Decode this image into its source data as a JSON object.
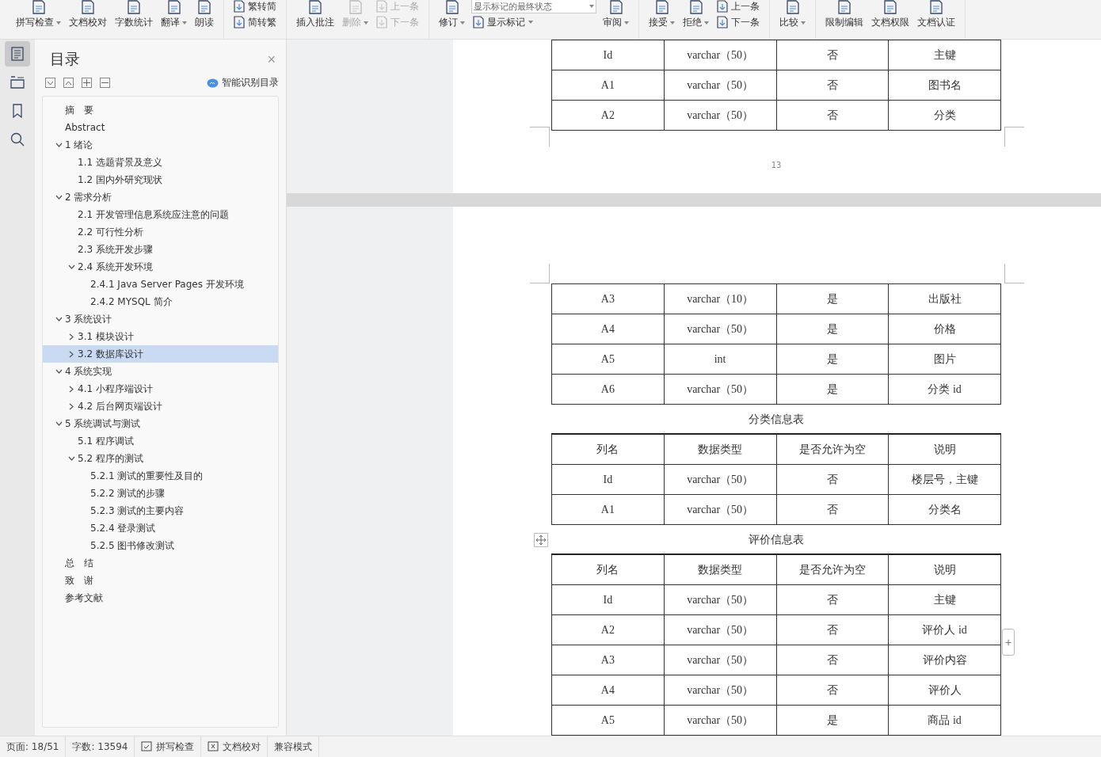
{
  "toolbar": {
    "groups": [
      {
        "items": [
          {
            "kind": "big",
            "label": "拼写检查",
            "caret": true,
            "disabled": false
          },
          {
            "kind": "big",
            "label": "文档校对",
            "caret": false,
            "disabled": false
          },
          {
            "kind": "big",
            "label": "字数统计",
            "caret": false,
            "disabled": false
          },
          {
            "kind": "big",
            "label": "翻译",
            "caret": true,
            "disabled": false
          },
          {
            "kind": "big",
            "label": "朗读",
            "caret": false,
            "disabled": false
          }
        ]
      },
      {
        "items": [
          {
            "kind": "stack",
            "rows": [
              {
                "label": "繁转简",
                "caret": false,
                "disabled": false
              },
              {
                "label": "简转繁",
                "caret": false,
                "disabled": false
              }
            ]
          }
        ]
      },
      {
        "items": [
          {
            "kind": "big",
            "label": "插入批注",
            "caret": false,
            "disabled": false
          },
          {
            "kind": "big",
            "label": "删除",
            "caret": true,
            "disabled": true
          },
          {
            "kind": "stack",
            "rows": [
              {
                "label": "上一条",
                "caret": false,
                "disabled": true
              },
              {
                "label": "下一条",
                "caret": false,
                "disabled": true
              }
            ]
          }
        ]
      },
      {
        "items": [
          {
            "kind": "big",
            "label": "修订",
            "caret": true,
            "disabled": false
          },
          {
            "kind": "stack",
            "rows": [
              {
                "label": "显示标记的最终状态",
                "caret": true,
                "field": true
              },
              {
                "label": "显示标记",
                "caret": true,
                "disabled": false
              }
            ]
          },
          {
            "kind": "big",
            "label": "审阅",
            "caret": true,
            "disabled": false
          }
        ]
      },
      {
        "items": [
          {
            "kind": "big",
            "label": "接受",
            "caret": true,
            "disabled": false
          },
          {
            "kind": "big",
            "label": "拒绝",
            "caret": true,
            "disabled": false
          },
          {
            "kind": "stack",
            "rows": [
              {
                "label": "上一条",
                "caret": false,
                "disabled": false
              },
              {
                "label": "下一条",
                "caret": false,
                "disabled": false
              }
            ]
          }
        ]
      },
      {
        "items": [
          {
            "kind": "big",
            "label": "比较",
            "caret": true,
            "disabled": false
          }
        ]
      },
      {
        "items": [
          {
            "kind": "big",
            "label": "限制编辑",
            "caret": false,
            "disabled": false
          },
          {
            "kind": "big",
            "label": "文档权限",
            "caret": false,
            "disabled": false
          },
          {
            "kind": "big",
            "label": "文档认证",
            "caret": false,
            "disabled": false
          }
        ]
      }
    ]
  },
  "rail": [
    {
      "kind": "toc",
      "selected": true
    },
    {
      "kind": "outline",
      "selected": false
    },
    {
      "kind": "bookmark",
      "selected": false
    },
    {
      "kind": "search",
      "selected": false
    }
  ],
  "toc": {
    "title": "目录",
    "close": "×",
    "smart_link": "智能识别目录",
    "items": [
      {
        "label": "摘　要"
      },
      {
        "label": "Abstract"
      },
      {
        "label": "1 绪论",
        "expanded": true,
        "children": [
          {
            "label": "1.1  选题背景及意义"
          },
          {
            "label": "1.2  国内外研究现状"
          }
        ]
      },
      {
        "label": "2 需求分析",
        "expanded": true,
        "children": [
          {
            "label": "2.1 开发管理信息系统应注意的问题"
          },
          {
            "label": "2.2 可行性分析"
          },
          {
            "label": "2.3 系统开发步骤"
          },
          {
            "label": "2.4 系统开发环境",
            "expanded": true,
            "children": [
              {
                "label": "2.4.1 Java Server Pages 开发环境"
              },
              {
                "label": "2.4.2 MYSQL 简介"
              }
            ]
          }
        ]
      },
      {
        "label": "3 系统设计",
        "expanded": true,
        "children": [
          {
            "label": "3.1  模块设计",
            "expanded": false,
            "selected": false
          },
          {
            "label": "3.2 数据库设计",
            "expanded": false,
            "selected": true
          }
        ]
      },
      {
        "label": "4 系统实现",
        "expanded": true,
        "children": [
          {
            "label": "4.1 小程序端设计",
            "expanded": false
          },
          {
            "label": "4.2 后台网页端设计",
            "expanded": false
          }
        ]
      },
      {
        "label": "5 系统调试与测试",
        "expanded": true,
        "children": [
          {
            "label": "5.1  程序调试"
          },
          {
            "label": "5.2  程序的测试",
            "expanded": true,
            "children": [
              {
                "label": "5.2.1  测试的重要性及目的"
              },
              {
                "label": "5.2.2  测试的步骤"
              },
              {
                "label": "5.2.3  测试的主要内容"
              },
              {
                "label": "5.2.4 登录测试"
              },
              {
                "label": "5.2.5 图书修改测试"
              }
            ]
          }
        ]
      },
      {
        "label": "总　结"
      },
      {
        "label": "致　谢"
      },
      {
        "label": "参考文献"
      }
    ]
  },
  "page1": {
    "rows": [
      [
        "Id",
        "varchar（50）",
        "否",
        "主键"
      ],
      [
        "A1",
        "varchar（50）",
        "否",
        "图书名"
      ],
      [
        "A2",
        "varchar（50）",
        "否",
        "分类"
      ]
    ],
    "page_number": "13"
  },
  "page2": {
    "blocks": [
      {
        "kind": "table",
        "rows": [
          [
            "A3",
            "varchar（10）",
            "是",
            "出版社"
          ],
          [
            "A4",
            "varchar（50）",
            "是",
            "价格"
          ],
          [
            "A5",
            "int",
            "是",
            "图片"
          ],
          [
            "A6",
            "varchar（50）",
            "是",
            "分类 id"
          ]
        ]
      },
      {
        "kind": "caption",
        "text": "分类信息表"
      },
      {
        "kind": "table",
        "header": [
          "列名",
          "数据类型",
          "是否允许为空",
          "说明"
        ],
        "rows": [
          [
            "Id",
            "varchar（50）",
            "否",
            "楼层号，主键"
          ],
          [
            "A1",
            "varchar（50）",
            "否",
            "分类名"
          ]
        ]
      },
      {
        "kind": "caption",
        "text": "评价信息表",
        "handle": true
      },
      {
        "kind": "table",
        "header": [
          "列名",
          "数据类型",
          "是否允许为空",
          "说明"
        ],
        "rows": [
          [
            "Id",
            "varchar（50）",
            "否",
            "主键"
          ],
          [
            "A2",
            "varchar（50）",
            "否",
            "评价人 id"
          ],
          [
            "A3",
            "varchar（50）",
            "否",
            "评价内容"
          ],
          [
            "A4",
            "varchar（50）",
            "否",
            "评价人"
          ],
          [
            "A5",
            "varchar（50）",
            "是",
            "商品 id"
          ]
        ]
      }
    ]
  },
  "add_row_button": "+",
  "status_bar": [
    {
      "kind": "text",
      "label": "页面: 18/51"
    },
    {
      "kind": "text",
      "label": "字数: 13594"
    },
    {
      "kind": "check",
      "label": "拼写检查"
    },
    {
      "kind": "cross",
      "label": "文档校对"
    },
    {
      "kind": "text",
      "label": "兼容模式"
    }
  ]
}
